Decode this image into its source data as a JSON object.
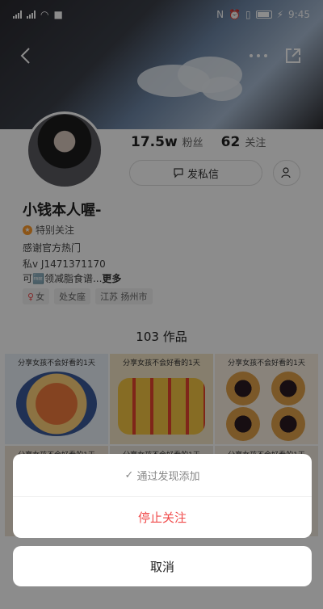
{
  "status_bar": {
    "time": "9:45",
    "battery": "87"
  },
  "profile": {
    "name": "小钱本人喔-",
    "followers_count": "17.5w",
    "followers_label": "粉丝",
    "following_count": "62",
    "following_label": "关注",
    "dm_button_label": "发私信",
    "special_follow_label": "特别关注",
    "bio_lines": [
      "感谢官方热门",
      "私v J1471371170",
      "可🆓领减脂食谱..."
    ],
    "bio_more_label": "更多",
    "tags": [
      "女",
      "处女座",
      "江苏 扬州市"
    ],
    "works_count": "103",
    "works_label": "作品"
  },
  "grid": {
    "captions": [
      "分享女孩不会好看的1天",
      "分享女孩不会好看的1天",
      "分享女孩不会好看的1天",
      "分享女孩不会好看的1天",
      "分享女孩不会好看的1天",
      "分享女孩不会好看的1天"
    ]
  },
  "action_sheet": {
    "info_label": "通过发现添加",
    "stop_follow_label": "停止关注",
    "cancel_label": "取消"
  },
  "colors": {
    "accent_red": "#f04a4a",
    "badge_orange": "#ff9c2a"
  }
}
